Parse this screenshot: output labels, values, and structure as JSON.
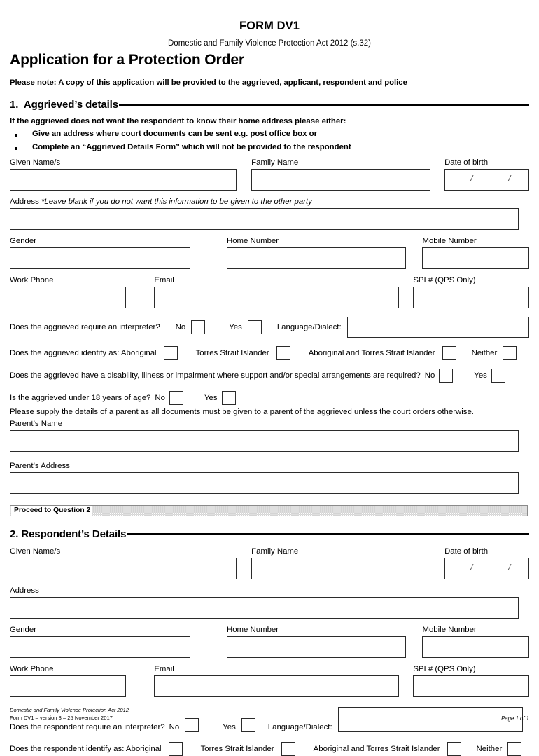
{
  "header": {
    "form_title": "FORM DV1",
    "act_line": "Domestic and Family Violence Protection Act 2012 (s.32)",
    "main_title": "Application for a Protection Order",
    "please_note": "Please note: A copy of this application will be provided to the aggrieved, applicant, respondent and police"
  },
  "section1": {
    "heading": "1.  Aggrieved’s details",
    "intro": "If the aggrieved does not want the respondent to know their home address please either:",
    "bullets": [
      "Give an address where court documents can be sent e.g. post office box or",
      "Complete an “Aggrieved Details Form” which will not be provided to the respondent"
    ],
    "labels": {
      "given_names": "Given Name/s",
      "family_name": "Family Name",
      "date_of_birth": "Date of birth",
      "address": "Address",
      "address_note": "*Leave blank if you do not want this information to be given to the other party",
      "gender": "Gender",
      "home_number": "Home Number",
      "mobile_number": "Mobile Number",
      "work_phone": "Work Phone",
      "email": "Email",
      "spi": "SPI # (QPS Only)",
      "parents_name": "Parent’s Name",
      "parents_address": "Parent’s Address"
    },
    "values": {
      "given_names": "",
      "family_name": "",
      "dob_sep1": "/",
      "dob_sep2": "/",
      "address": "",
      "gender": "",
      "home_number": "",
      "mobile_number": "",
      "work_phone": "",
      "email": "",
      "spi": "",
      "language_dialect": "",
      "parents_name": "",
      "parents_address": ""
    },
    "q_interpreter": {
      "question": "Does the aggrieved require an interpreter?",
      "no": "No",
      "yes": "Yes",
      "lang_label": "Language/Dialect:"
    },
    "q_identify": {
      "question": "Does the aggrieved identify as: Aboriginal",
      "opt2": "Torres Strait Islander",
      "opt3": "Aboriginal and Torres Strait Islander",
      "opt4": "Neither"
    },
    "q_disability": {
      "question": "Does the aggrieved have a disability, illness or impairment where support and/or special arrangements are required?",
      "no": "No",
      "yes": "Yes"
    },
    "q_under18": {
      "question": "Is the aggrieved under 18 years of age?",
      "no": "No",
      "yes": "Yes",
      "note": "Please supply the details of a parent as all documents must be given to a parent of the aggrieved unless the court orders otherwise."
    },
    "proceed_label": "Proceed to Question 2"
  },
  "section2": {
    "heading": "2. Respondent’s Details",
    "labels": {
      "given_names": "Given Name/s",
      "family_name": "Family Name",
      "date_of_birth": "Date of birth",
      "address": "Address",
      "gender": "Gender",
      "home_number": "Home Number",
      "mobile_number": "Mobile Number",
      "work_phone": "Work Phone",
      "email": "Email",
      "spi": "SPI # (QPS Only)"
    },
    "values": {
      "given_names": "",
      "family_name": "",
      "dob_sep1": "/",
      "dob_sep2": "/",
      "address": "",
      "gender": "",
      "home_number": "",
      "mobile_number": "",
      "work_phone": "",
      "email": "",
      "spi": "",
      "language_dialect": ""
    },
    "q_interpreter": {
      "question": "Does the respondent require an interpreter?",
      "no": "No",
      "yes": "Yes",
      "lang_label": "Language/Dialect:"
    },
    "q_identify": {
      "question": "Does the respondent identify as: Aboriginal",
      "opt2": "Torres Strait Islander",
      "opt3": "Aboriginal and Torres Strait Islander",
      "opt4": "Neither"
    }
  },
  "footer": {
    "line1": "Domestic and Family Violence Protection Act 2012",
    "line2": "Form DV1 – version 3 – 25 November 2017",
    "page": "Page 1 of 1"
  }
}
